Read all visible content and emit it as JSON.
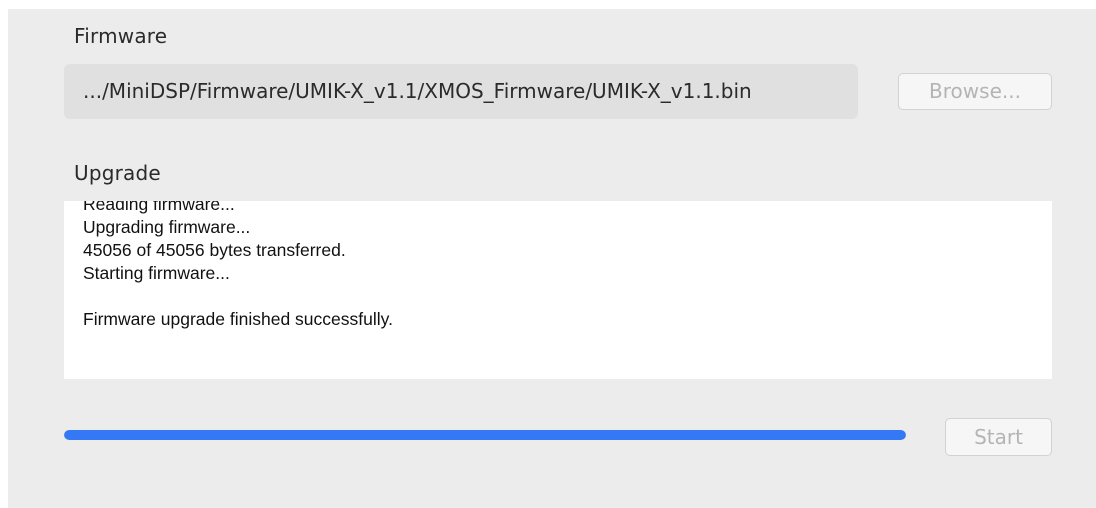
{
  "firmware": {
    "label": "Firmware",
    "path": ".../MiniDSP/Firmware/UMIK-X_v1.1/XMOS_Firmware/UMIK-X_v1.1.bin",
    "browse_label": "Browse..."
  },
  "upgrade": {
    "label": "Upgrade",
    "log_lines": [
      "Reading firmware...",
      "Upgrading firmware...",
      "45056 of 45056 bytes transferred.",
      "Starting firmware...",
      "",
      "Firmware upgrade finished successfully."
    ],
    "progress_percent": 100,
    "start_label": "Start"
  },
  "colors": {
    "progress_fill": "#3478f6",
    "panel_bg": "#ececec",
    "disabled_text": "#b4b4b4"
  }
}
